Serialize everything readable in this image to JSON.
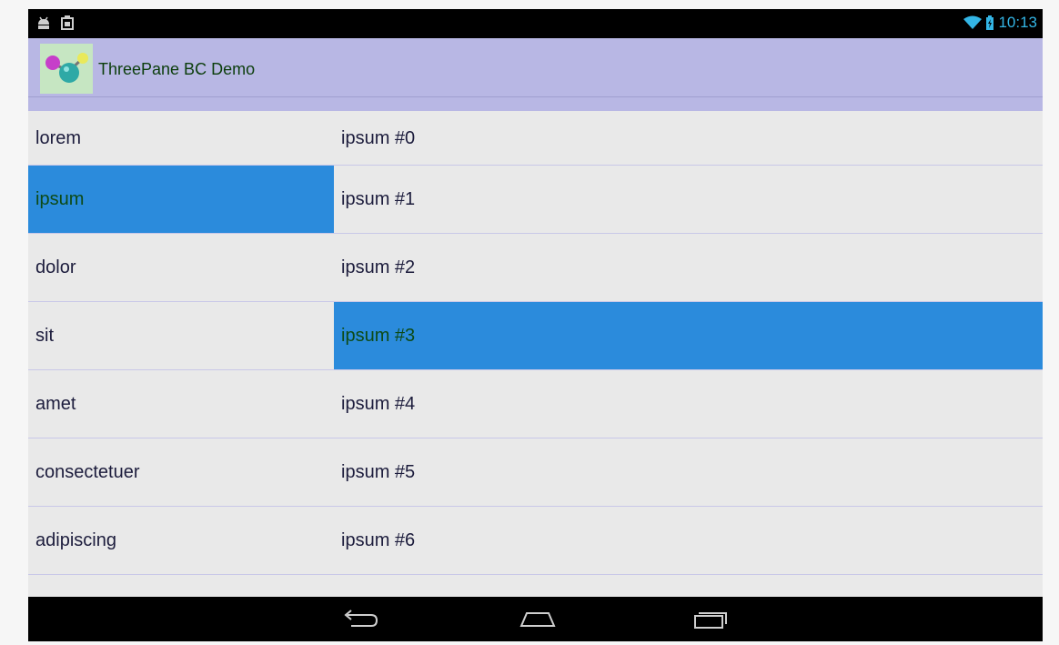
{
  "status_bar": {
    "left_icons": [
      "android-debug-icon",
      "notification-icon"
    ],
    "time": "10:13",
    "right_icons": [
      "wifi-icon",
      "battery-icon"
    ]
  },
  "action_bar": {
    "title": "ThreePane BC Demo",
    "icon": "molecule-app-icon"
  },
  "list": {
    "rows": [
      {
        "left": "lorem",
        "right": "ipsum #0",
        "left_selected": false,
        "right_selected": false
      },
      {
        "left": "ipsum",
        "right": "ipsum #1",
        "left_selected": true,
        "right_selected": false
      },
      {
        "left": "dolor",
        "right": "ipsum #2",
        "left_selected": false,
        "right_selected": false
      },
      {
        "left": "sit",
        "right": "ipsum #3",
        "left_selected": false,
        "right_selected": true
      },
      {
        "left": "amet",
        "right": "ipsum #4",
        "left_selected": false,
        "right_selected": false
      },
      {
        "left": "consectetuer",
        "right": "ipsum #5",
        "left_selected": false,
        "right_selected": false
      },
      {
        "left": "adipiscing",
        "right": "ipsum #6",
        "left_selected": false,
        "right_selected": false
      }
    ]
  },
  "nav_bar": {
    "buttons": [
      "back-icon",
      "home-icon",
      "recents-icon"
    ]
  },
  "colors": {
    "action_bar": "#b8b7e4",
    "selected": "#2b8bdc",
    "status_accent": "#33b5e5"
  }
}
